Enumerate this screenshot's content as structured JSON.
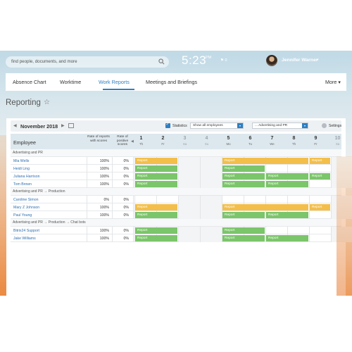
{
  "search": {
    "placeholder": "find people, documents, and more"
  },
  "clock": {
    "time": "5:23",
    "ampm": "PM",
    "flag": "⚑ 0"
  },
  "user": {
    "name": "Jennifer Warner"
  },
  "tabs": [
    {
      "label": "Absence Chart"
    },
    {
      "label": "Worktime"
    },
    {
      "label": "Work Reports"
    },
    {
      "label": "Meetings and Briefings"
    }
  ],
  "more_label": "More",
  "page": {
    "title": "Reporting",
    "star": "☆"
  },
  "toolbar": {
    "month": "November 2018",
    "statistics_label": "Statistics",
    "employees_select": "Show all employees",
    "department_select": "... Advertising and PR",
    "settings_label": "Settings"
  },
  "header": {
    "employee": "Employee",
    "rate_reports": "Rate of reports with scores",
    "rate_positive": "Rate of positive scores"
  },
  "days": [
    {
      "num": "1",
      "name": "Th",
      "weekend": false
    },
    {
      "num": "2",
      "name": "Fr",
      "weekend": false
    },
    {
      "num": "3",
      "name": "Sa",
      "weekend": true
    },
    {
      "num": "4",
      "name": "Su",
      "weekend": true
    },
    {
      "num": "5",
      "name": "Mo",
      "weekend": false
    },
    {
      "num": "6",
      "name": "Tu",
      "weekend": false
    },
    {
      "num": "7",
      "name": "We",
      "weekend": false
    },
    {
      "num": "8",
      "name": "Th",
      "weekend": false
    },
    {
      "num": "9",
      "name": "Fr",
      "weekend": false
    },
    {
      "num": "10",
      "name": "Sa",
      "weekend": true
    }
  ],
  "groups": [
    {
      "label": "Advertising and PR",
      "rows": [
        {
          "name": "Mia Wells",
          "rate": "100%",
          "positive": "0%"
        },
        {
          "name": "Heidi Ling",
          "rate": "100%",
          "positive": "0%"
        },
        {
          "name": "Juliana Harrison",
          "rate": "100%",
          "positive": "0%"
        },
        {
          "name": "Tom Brown",
          "rate": "100%",
          "positive": "0%"
        }
      ]
    },
    {
      "label": "Advertising and PR  →  Production",
      "rows": [
        {
          "name": "Caroline Simon",
          "rate": "0%",
          "positive": "0%"
        },
        {
          "name": "Mary Z Johnson",
          "rate": "100%",
          "positive": "0%"
        },
        {
          "name": "Paul Young",
          "rate": "100%",
          "positive": "0%"
        }
      ]
    },
    {
      "label": "Advertising and PR  →  Production  →  Chat bots",
      "rows": [
        {
          "name": "Bitrix24 Support",
          "rate": "100%",
          "positive": "0%"
        },
        {
          "name": "Jake Williams",
          "rate": "100%",
          "positive": "0%"
        }
      ]
    }
  ],
  "bar_label": "Report",
  "colors": {
    "accent": "#2f7fc1",
    "report_green": "#7bc56a",
    "report_orange": "#f3bf4a"
  }
}
